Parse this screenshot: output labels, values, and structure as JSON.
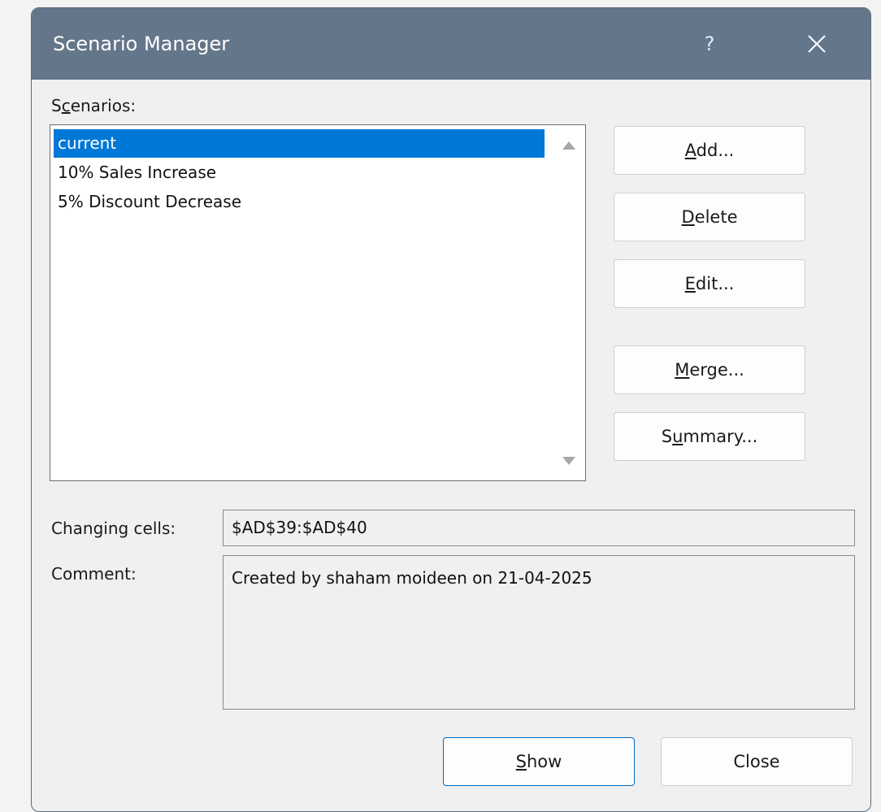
{
  "dialog": {
    "title": "Scenario Manager",
    "help_label": "?"
  },
  "scenarios": {
    "label_pre": "S",
    "label_key": "c",
    "label_post": "enarios:",
    "items": [
      {
        "label": "current",
        "selected": true
      },
      {
        "label": "10% Sales Increase",
        "selected": false
      },
      {
        "label": "5% Discount Decrease",
        "selected": false
      }
    ]
  },
  "buttons": {
    "add": {
      "pre": "",
      "key": "A",
      "post": "dd..."
    },
    "delete": {
      "pre": "",
      "key": "D",
      "post": "elete"
    },
    "edit": {
      "pre": "",
      "key": "E",
      "post": "dit..."
    },
    "merge": {
      "pre": "",
      "key": "M",
      "post": "erge..."
    },
    "summary": {
      "pre": "S",
      "key": "u",
      "post": "mmary..."
    },
    "show": {
      "pre": "",
      "key": "S",
      "post": "how"
    },
    "close": {
      "label": "Close"
    }
  },
  "details": {
    "changing_cells_label": "Changing cells:",
    "changing_cells_value": "$AD$39:$AD$40",
    "comment_label": "Comment:",
    "comment_value": "Created by shaham moideen on 21-04-2025"
  },
  "colors": {
    "titlebar": "#64768a",
    "selection": "#0078d7",
    "primary_border": "#0067c0"
  },
  "icons": {
    "close": "close-icon",
    "scroll_up": "triangle-up-icon",
    "scroll_down": "triangle-down-icon"
  }
}
